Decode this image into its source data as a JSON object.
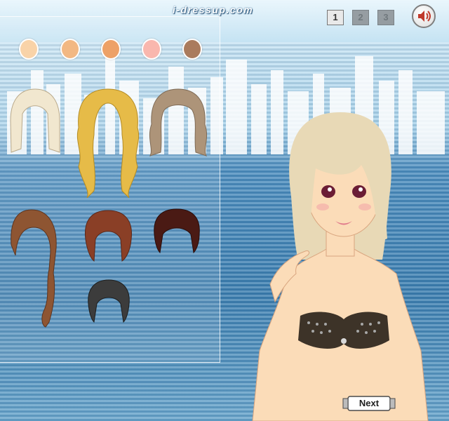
{
  "site": {
    "brand": "i-dressup.com"
  },
  "pagination": {
    "pages": [
      "1",
      "2",
      "3"
    ],
    "current": "1"
  },
  "sound": {
    "icon": "speaker-icon"
  },
  "skin_swatches": [
    {
      "name": "swatch-ivory",
      "color": "#f9d3a8"
    },
    {
      "name": "swatch-beige",
      "color": "#f2b883"
    },
    {
      "name": "swatch-tan",
      "color": "#eda167"
    },
    {
      "name": "swatch-pink",
      "color": "#f9b7ae"
    },
    {
      "name": "swatch-brown",
      "color": "#aa7b5d"
    }
  ],
  "hairstyles": [
    {
      "name": "platinum-bob",
      "color": "#f1e7cf"
    },
    {
      "name": "golden-curls",
      "color": "#e6bb48"
    },
    {
      "name": "ash-wavy",
      "color": "#ad9479"
    },
    {
      "name": "brown-braid",
      "color": "#8e5532"
    },
    {
      "name": "auburn-short",
      "color": "#8a3f26"
    },
    {
      "name": "dark-red-short",
      "color": "#4a1a14"
    },
    {
      "name": "black-pompadour",
      "color": "#3c3c3c"
    }
  ],
  "model": {
    "hair_color": "#e8d9b6",
    "skin_color": "#fbdcb8",
    "eye_color": "#6b1d35",
    "top_color": "#3d3328"
  },
  "buttons": {
    "next": "Next"
  }
}
